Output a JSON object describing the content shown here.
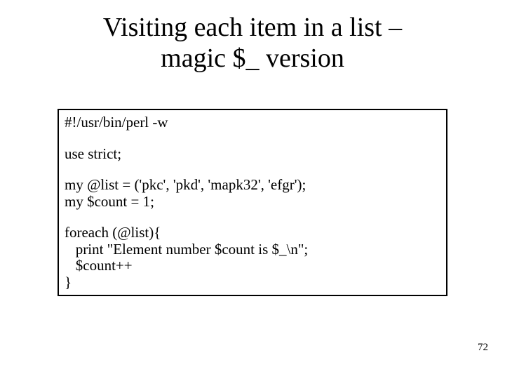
{
  "title_line1": "Visiting each item in a list –",
  "title_line2": "magic $_ version",
  "code": {
    "l1": "#!/usr/bin/perl -w",
    "l2": "use strict;",
    "l3": "my @list = ('pkc', 'pkd', 'mapk32', 'efgr');",
    "l4": "my $count = 1;",
    "l5": "foreach (@list){",
    "l6": "   print \"Element number $count is $_\\n\";",
    "l7": "   $count++",
    "l8": "}"
  },
  "page_number": "72"
}
